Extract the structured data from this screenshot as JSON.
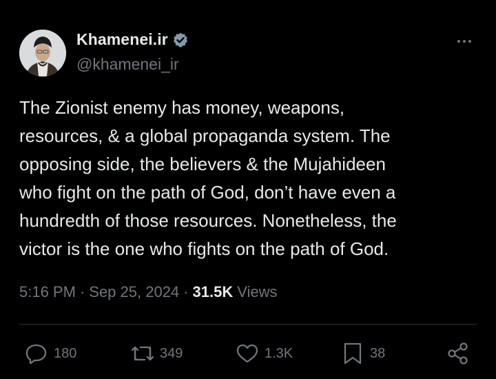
{
  "author": {
    "display_name": "Khamenei.ir",
    "handle": "@khamenei_ir",
    "verified": true
  },
  "tweet": {
    "text": "The Zionist enemy has money, weapons,\nresources, & a global propaganda system. The\nopposing side, the believers & the Mujahideen\nwho fight on the path of God, don’t have even a\nhundredth of those resources. Nonetheless, the\nvictor is the one who fights on the path of God."
  },
  "meta": {
    "time": "5:16 PM",
    "separator": "·",
    "date": "Sep 25, 2024",
    "views_count": "31.5K",
    "views_label": "Views"
  },
  "actions": {
    "replies": "180",
    "retweets": "349",
    "likes": "1.3K",
    "bookmarks": "38"
  },
  "icons": {
    "more": "more-horizontal-icon",
    "verified": "verified-badge-icon",
    "reply": "reply-icon",
    "retweet": "retweet-icon",
    "like": "heart-icon",
    "bookmark": "bookmark-icon",
    "share": "share-icon"
  },
  "colors": {
    "background": "#000000",
    "text": "#e7e9ea",
    "secondary": "#71767b",
    "divider": "#2f3336",
    "verified": "#829aab"
  }
}
